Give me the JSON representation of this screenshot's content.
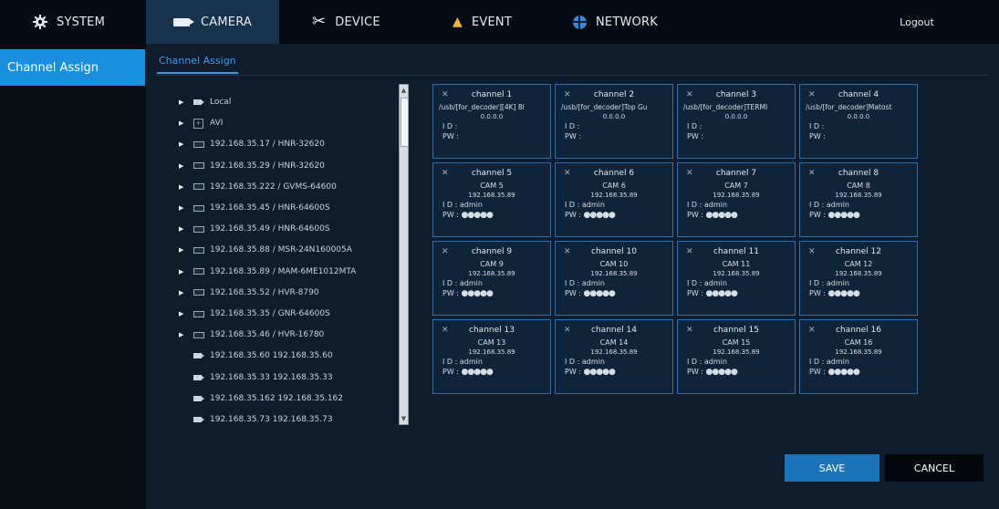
{
  "topnav": {
    "tabs": [
      {
        "label": "SYSTEM",
        "icon": "gear-icon"
      },
      {
        "label": "CAMERA",
        "icon": "camera-icon"
      },
      {
        "label": "DEVICE",
        "icon": "tools-icon"
      },
      {
        "label": "EVENT",
        "icon": "bell-icon"
      },
      {
        "label": "NETWORK",
        "icon": "globe-icon"
      }
    ],
    "logout": "Logout"
  },
  "sidebar": {
    "items": [
      {
        "label": "Channel Assign"
      }
    ]
  },
  "main": {
    "subtab": "Channel Assign"
  },
  "tree": {
    "items": [
      {
        "label": "Local",
        "icon": "camera-icon",
        "expandable": true
      },
      {
        "label": "AVI",
        "icon": "avi-icon",
        "expandable": true
      },
      {
        "label": "192.168.35.17 / HNR-32620",
        "icon": "nvr-icon",
        "expandable": true
      },
      {
        "label": "192.168.35.29 / HNR-32620",
        "icon": "nvr-icon",
        "expandable": true
      },
      {
        "label": "192.168.35.222 / GVMS-64600",
        "icon": "nvr-icon",
        "expandable": true
      },
      {
        "label": "192.168.35.45 / HNR-64600S",
        "icon": "nvr-icon",
        "expandable": true
      },
      {
        "label": "192.168.35.49 / HNR-64600S",
        "icon": "nvr-icon",
        "expandable": true
      },
      {
        "label": "192.168.35.88 / MSR-24N160005A",
        "icon": "nvr-icon",
        "expandable": true
      },
      {
        "label": "192.168.35.89 / MAM-6ME1012MTA",
        "icon": "nvr-icon",
        "expandable": true
      },
      {
        "label": "192.168.35.52 / HVR-8790",
        "icon": "nvr-icon",
        "expandable": true
      },
      {
        "label": "192.168.35.35 / GNR-64600S",
        "icon": "nvr-icon",
        "expandable": true
      },
      {
        "label": "192.168.35.46 / HVR-16780",
        "icon": "nvr-icon",
        "expandable": true
      },
      {
        "label": "192.168.35.60 192.168.35.60",
        "icon": "camera-icon",
        "expandable": false
      },
      {
        "label": "192.168.35.33 192.168.35.33",
        "icon": "camera-icon",
        "expandable": false
      },
      {
        "label": "192.168.35.162 192.168.35.162",
        "icon": "camera-icon",
        "expandable": false
      },
      {
        "label": "192.168.35.73 192.168.35.73",
        "icon": "camera-icon",
        "expandable": false
      }
    ]
  },
  "channels": [
    {
      "name": "channel 1",
      "line1": "/usb/[for_decoder][4K] 8l",
      "line2": "0.0.0.0",
      "id": "I D :",
      "pw": "PW :",
      "dots": ""
    },
    {
      "name": "channel 2",
      "line1": "/usb/[for_decoder]Top Gu",
      "line2": "0.0.0.0",
      "id": "I D :",
      "pw": "PW :",
      "dots": ""
    },
    {
      "name": "channel 3",
      "line1": "/usb/[for_decoder]TERMI",
      "line2": "0.0.0.0",
      "id": "I D :",
      "pw": "PW :",
      "dots": ""
    },
    {
      "name": "channel 4",
      "line1": "/usb/[for_decoder]Matost",
      "line2": "0.0.0.0",
      "id": "I D :",
      "pw": "PW :",
      "dots": ""
    },
    {
      "name": "channel 5",
      "line1": "CAM 5",
      "line2": "192.168.35.89",
      "id": "I D : admin",
      "pw": "PW :",
      "dots": "●●●●●"
    },
    {
      "name": "channel 6",
      "line1": "CAM 6",
      "line2": "192.168.35.89",
      "id": "I D : admin",
      "pw": "PW :",
      "dots": "●●●●●"
    },
    {
      "name": "channel 7",
      "line1": "CAM 7",
      "line2": "192.168.35.89",
      "id": "I D : admin",
      "pw": "PW :",
      "dots": "●●●●●"
    },
    {
      "name": "channel 8",
      "line1": "CAM 8",
      "line2": "192.168.35.89",
      "id": "I D : admin",
      "pw": "PW :",
      "dots": "●●●●●"
    },
    {
      "name": "channel 9",
      "line1": "CAM 9",
      "line2": "192.168.35.89",
      "id": "I D : admin",
      "pw": "PW :",
      "dots": "●●●●●"
    },
    {
      "name": "channel 10",
      "line1": "CAM 10",
      "line2": "192.168.35.89",
      "id": "I D : admin",
      "pw": "PW :",
      "dots": "●●●●●"
    },
    {
      "name": "channel 11",
      "line1": "CAM 11",
      "line2": "192.168.35.89",
      "id": "I D : admin",
      "pw": "PW :",
      "dots": "●●●●●"
    },
    {
      "name": "channel 12",
      "line1": "CAM 12",
      "line2": "192.168.35.89",
      "id": "I D : admin",
      "pw": "PW :",
      "dots": "●●●●●"
    },
    {
      "name": "channel 13",
      "line1": "CAM 13",
      "line2": "192.168.35.89",
      "id": "I D : admin",
      "pw": "PW :",
      "dots": "●●●●●"
    },
    {
      "name": "channel 14",
      "line1": "CAM 14",
      "line2": "192.168.35.89",
      "id": "I D : admin",
      "pw": "PW :",
      "dots": "●●●●●"
    },
    {
      "name": "channel 15",
      "line1": "CAM 15",
      "line2": "192.168.35.89",
      "id": "I D : admin",
      "pw": "PW :",
      "dots": "●●●●●"
    },
    {
      "name": "channel 16",
      "line1": "CAM 16",
      "line2": "192.168.35.89",
      "id": "I D : admin",
      "pw": "PW :",
      "dots": "●●●●●"
    }
  ],
  "actions": {
    "save": "SAVE",
    "cancel": "CANCEL"
  },
  "colors": {
    "accent": "#1a8fe0",
    "cell_border": "#2a6fb0",
    "background": "#0e1c2b"
  }
}
